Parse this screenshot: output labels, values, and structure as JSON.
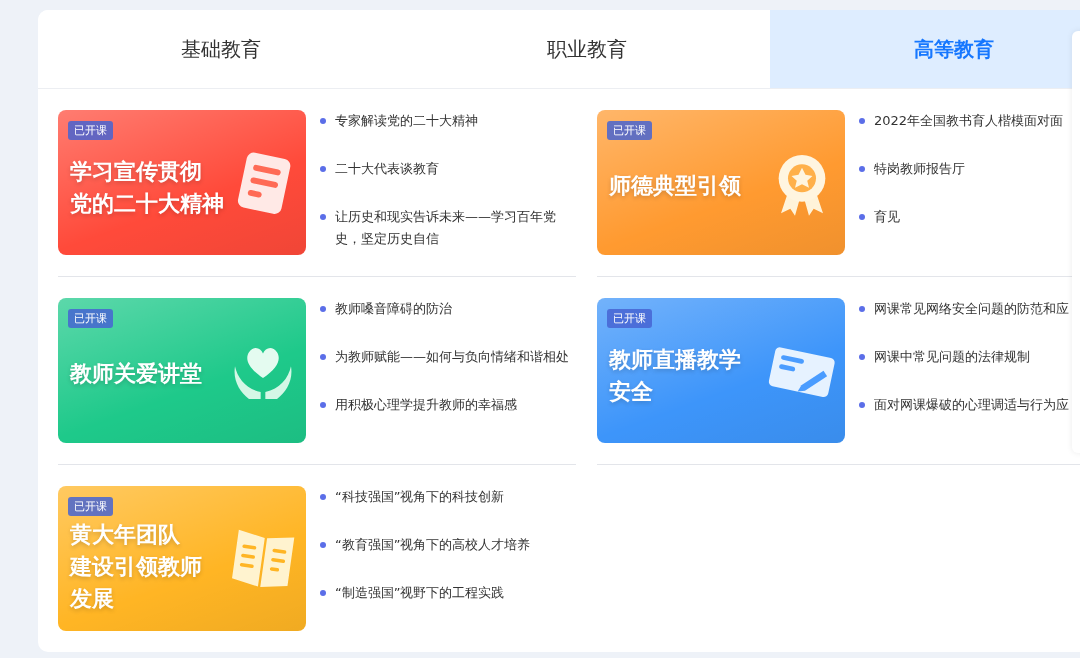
{
  "tabs": [
    {
      "label": "基础教育",
      "selected": false
    },
    {
      "label": "职业教育",
      "selected": false
    },
    {
      "label": "高等教育",
      "selected": true
    }
  ],
  "courses": [
    {
      "badge": "已开课",
      "title_lines": [
        "学习宣传贯彻",
        "党的二十大精神"
      ],
      "color": "#ff4a3a",
      "kind": "document",
      "topics": [
        "专家解读党的二十大精神",
        "二十大代表谈教育",
        "让历史和现实告诉未来——学习百年党史，坚定历史自信"
      ]
    },
    {
      "badge": "已开课",
      "title_lines": [
        "师德典型引领"
      ],
      "color": "#ff9a30",
      "kind": "medal",
      "topics": [
        "2022年全国教书育人楷模面对面",
        "特岗教师报告厅",
        "育见"
      ]
    },
    {
      "badge": "已开课",
      "title_lines": [
        "教师关爱讲堂"
      ],
      "color": "#1ec98a",
      "kind": "heart",
      "topics": [
        "教师嗓音障碍的防治",
        "为教师赋能——如何与负向情绪和谐相处",
        "用积极心理学提升教师的幸福感"
      ]
    },
    {
      "badge": "已开课",
      "title_lines": [
        "教师直播教学",
        "安全"
      ],
      "color": "#3d95fa",
      "kind": "pen",
      "topics": [
        "网课常见网络安全问题的防范和应",
        "网课中常见问题的法律规制",
        "面对网课爆破的心理调适与行为应"
      ]
    },
    {
      "badge": "已开课",
      "title_lines": [
        "黄大年团队",
        "建设引领教师",
        "发展"
      ],
      "color": "#ffb524",
      "kind": "book",
      "topics": [
        "“科技强国”视角下的科技创新",
        "“教育强国”视角下的高校人才培养",
        "“制造强国”视野下的工程实践"
      ]
    }
  ]
}
